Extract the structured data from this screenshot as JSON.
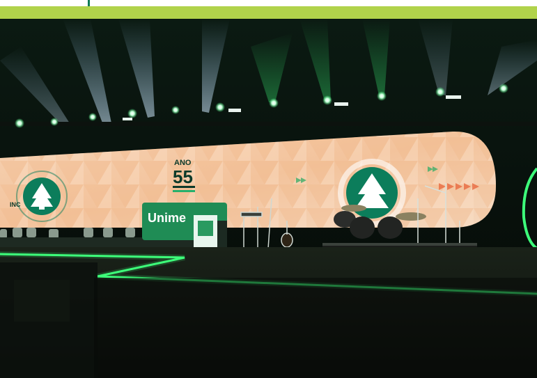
{
  "screen": {
    "ano_label": "ANO",
    "ano_number": "55",
    "side_text": "INC",
    "podium_brand": "Unime"
  },
  "colors": {
    "accent_green": "#b1d34b",
    "led_green": "#3dff7a",
    "screen_peach": "#f3c7a3",
    "logo_teal": "#0c7d5b"
  }
}
